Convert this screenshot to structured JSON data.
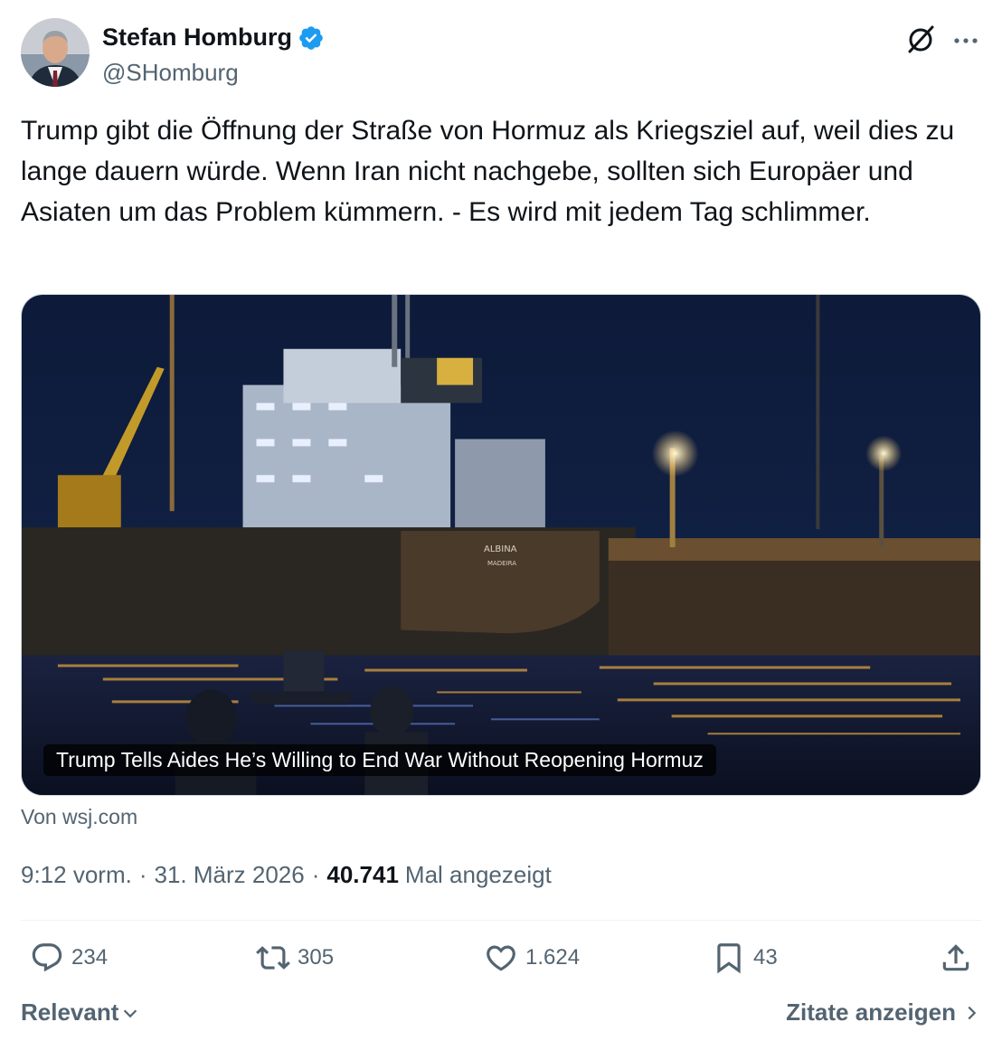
{
  "author": {
    "name": "Stefan Homburg",
    "handle": "@SHomburg",
    "verified": true,
    "verified_color": "#1d9bf0"
  },
  "header_icons": [
    "grok-icon",
    "more-icon"
  ],
  "tweet": {
    "text": "Trump gibt die Öffnung der Straße von Hormuz als Kriegsziel auf, weil dies zu lange dauern würde. Wenn Iran nicht nachgebe, sollten sich Europäer und Asiaten um das Problem kümmern. - Es wird mit jedem Tag schlimmer."
  },
  "card": {
    "title": "Trump Tells Aides He’s Willing to End War Without Reopening Hormuz",
    "image_description_icon": "ship-photo",
    "ship_name": "ALBINA",
    "ship_port": "MADEIRA",
    "source": "Von wsj.com"
  },
  "meta": {
    "time": "9:12 vorm.",
    "separator": "·",
    "date": "31. März 2026",
    "views_count": "40.741",
    "views_label": "Mal angezeigt"
  },
  "actions": {
    "replies": "234",
    "retweets": "305",
    "likes": "1.624",
    "bookmarks": "43"
  },
  "footer": {
    "sort_label": "Relevant",
    "quotes_label": "Zitate anzeigen"
  },
  "colors": {
    "text_primary": "#0f1419",
    "text_secondary": "#536471",
    "accent": "#1d9bf0",
    "divider": "#eff3f4"
  }
}
